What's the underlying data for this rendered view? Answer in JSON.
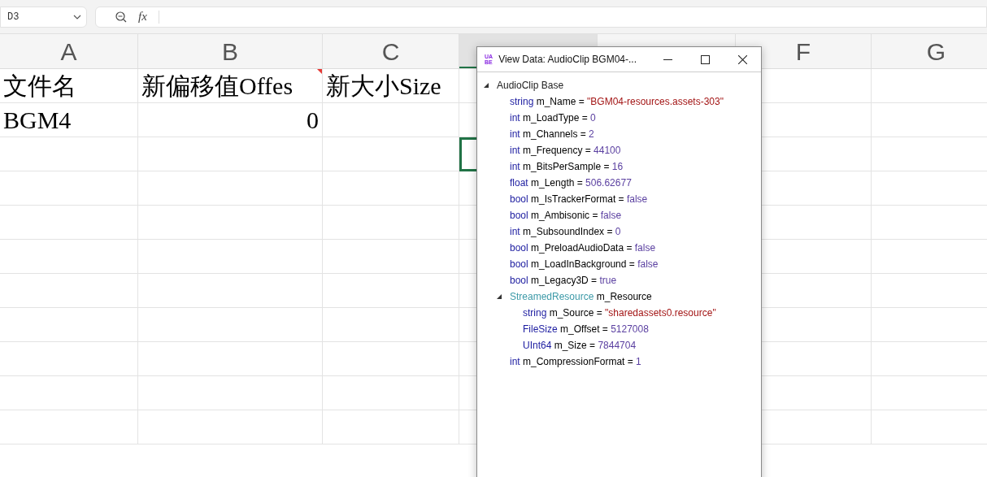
{
  "name_box": {
    "value": "D3"
  },
  "formula_bar": {
    "fx": "fx"
  },
  "columns": [
    {
      "label": "A",
      "selected": false
    },
    {
      "label": "B",
      "selected": false
    },
    {
      "label": "C",
      "selected": false
    },
    {
      "selected": true
    },
    {
      "selected": false
    },
    {
      "label": "F",
      "selected": false
    },
    {
      "label": "G",
      "selected": false
    }
  ],
  "rows": [
    {
      "cells": [
        {
          "text": "文件名",
          "kind": "text",
          "selected": false
        },
        {
          "text": "新偏移值Offes",
          "kind": "text",
          "has_comment": true,
          "selected": false
        },
        {
          "text": "新大小Size",
          "kind": "text",
          "selected": false
        }
      ]
    },
    {
      "cells": [
        {
          "text": "BGM4",
          "kind": "text",
          "selected": false
        },
        {
          "text": "0",
          "kind": "number",
          "selected": false
        }
      ]
    },
    {
      "cells": [
        {
          "selected": false
        },
        {
          "selected": false
        },
        {
          "selected": false
        },
        {
          "selected": true
        }
      ]
    }
  ],
  "dialog": {
    "logo": [
      "UA",
      "BE"
    ],
    "title": "View Data: AudioClip BGM04-...",
    "tree": [
      {
        "type": "AudioClip Base",
        "kind": "root",
        "expanded": true,
        "children": [
          {
            "type": "string",
            "kind": "string",
            "name": "m_Name =",
            "value": "\"BGM04-resources.assets-303\""
          },
          {
            "type": "int",
            "kind": "value",
            "name": "m_LoadType =",
            "value": "0"
          },
          {
            "type": "int",
            "kind": "value",
            "name": "m_Channels =",
            "value": "2"
          },
          {
            "type": "int",
            "kind": "value",
            "name": "m_Frequency =",
            "value": "44100"
          },
          {
            "type": "int",
            "kind": "value",
            "name": "m_BitsPerSample =",
            "value": "16"
          },
          {
            "type": "float",
            "kind": "value",
            "name": "m_Length =",
            "value": "506.62677"
          },
          {
            "type": "bool",
            "kind": "value",
            "name": "m_IsTrackerFormat =",
            "value": "false"
          },
          {
            "type": "bool",
            "kind": "value",
            "name": "m_Ambisonic =",
            "value": "false"
          },
          {
            "type": "int",
            "kind": "value",
            "name": "m_SubsoundIndex =",
            "value": "0"
          },
          {
            "type": "bool",
            "kind": "value",
            "name": "m_PreloadAudioData =",
            "value": "false"
          },
          {
            "type": "bool",
            "kind": "value",
            "name": "m_LoadInBackground =",
            "value": "false"
          },
          {
            "type": "bool",
            "kind": "value",
            "name": "m_Legacy3D =",
            "value": "true"
          },
          {
            "type": "StreamedResource",
            "kind": "object",
            "name": "m_Resource",
            "expanded": true,
            "children": [
              {
                "type": "string",
                "kind": "string",
                "name": "m_Source =",
                "value": "\"sharedassets0.resource\""
              },
              {
                "type": "FileSize",
                "kind": "value",
                "name": "m_Offset =",
                "value": "5127008"
              },
              {
                "type": "UInt64",
                "kind": "value",
                "name": "m_Size =",
                "value": "7844704"
              }
            ]
          },
          {
            "type": "int",
            "kind": "value",
            "name": "m_CompressionFormat =",
            "value": "1"
          }
        ]
      }
    ]
  }
}
